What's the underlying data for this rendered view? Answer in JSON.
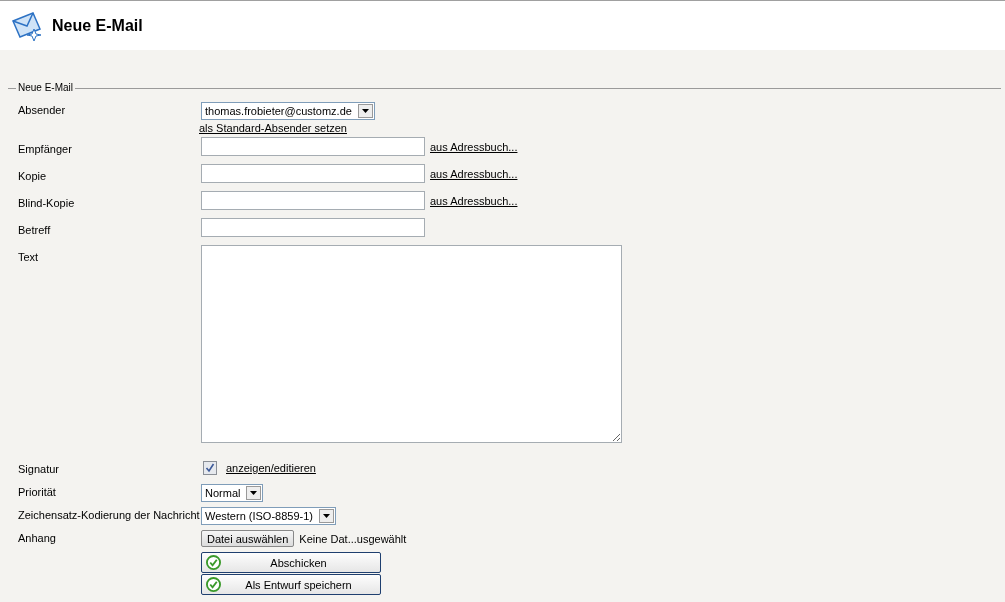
{
  "header": {
    "title": "Neue E-Mail"
  },
  "form": {
    "legend": "Neue E-Mail",
    "fields": [
      {
        "kind": "select",
        "label": "Absender",
        "value": "thomas.frobieter@customz.de",
        "link": "als Standard-Absender setzen"
      },
      {
        "kind": "input",
        "label": "Empfänger",
        "link": "aus Adressbuch..."
      },
      {
        "kind": "input",
        "label": "Kopie",
        "link": "aus Adressbuch..."
      },
      {
        "kind": "input",
        "label": "Blind-Kopie",
        "link": "aus Adressbuch..."
      },
      {
        "kind": "input",
        "label": "Betreff"
      },
      {
        "kind": "textarea",
        "label": "Text"
      },
      {
        "kind": "checkbox",
        "label": "Signatur",
        "checked": true,
        "link": "anzeigen/editieren"
      },
      {
        "kind": "select",
        "label": "Priorität",
        "value": "Normal"
      },
      {
        "kind": "select",
        "label": "Zeichensatz-Kodierung der Nachricht",
        "value": "Western (ISO-8859-1)"
      },
      {
        "kind": "file",
        "label": "Anhang",
        "button": "Datei auswählen",
        "status": "Keine Dat...usgewählt"
      }
    ],
    "buttons": [
      "Abschicken",
      "Als Entwurf speichern"
    ]
  }
}
